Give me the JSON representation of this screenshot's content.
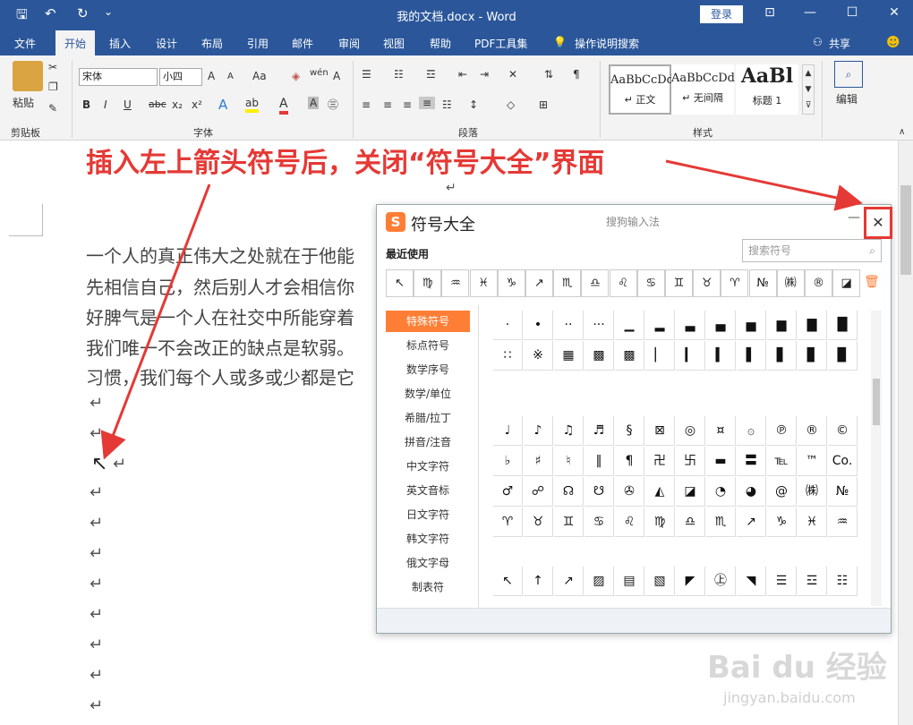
{
  "app": {
    "title": "我的文档.docx - Word",
    "login": "登录"
  },
  "qat": {
    "save": "🖫",
    "undo": "↶",
    "redo": "↻",
    "more": "⌄"
  },
  "window_controls": {
    "ribbon_opts": "⊡",
    "min": "—",
    "max": "☐",
    "close": "✕"
  },
  "tabs": [
    "文件",
    "开始",
    "插入",
    "设计",
    "布局",
    "引用",
    "邮件",
    "审阅",
    "视图",
    "帮助",
    "PDF工具集",
    "操作说明搜索"
  ],
  "share": "共享",
  "ribbon": {
    "clipboard": {
      "paste": "粘贴",
      "label": "剪贴板"
    },
    "font": {
      "name": "宋体",
      "size": "小四",
      "label": "字体",
      "buttons": [
        "A",
        "A",
        "Aa",
        "A"
      ],
      "format": [
        "B",
        "I",
        "U",
        "abc",
        "x₂",
        "x²"
      ]
    },
    "paragraph": {
      "label": "段落"
    },
    "styles": {
      "items": [
        {
          "preview": "AaBbCcDd",
          "name": "↵ 正文"
        },
        {
          "preview": "AaBbCcDd",
          "name": "↵ 无间隔"
        },
        {
          "preview": "AaBl",
          "name": "标题 1"
        }
      ],
      "label": "样式"
    },
    "editing": {
      "label": "编辑"
    }
  },
  "annotation": "插入左上箭头符号后，关闭“符号大全”界面",
  "document": {
    "lines": [
      "一个人的真正伟大之处就在于他能",
      "先相信自己，然后别人才会相信你",
      "好脾气是一个人在社交中所能穿着",
      "我们唯一不会改正的缺点是软弱。",
      "习惯，我们每个人或多或少都是它"
    ],
    "inserted_symbol": "↖",
    "return_mark": "↵"
  },
  "symbol_panel": {
    "logo": "S",
    "title": "符号大全",
    "ime": "搜狗输入法",
    "minimize": "—",
    "close": "✕",
    "recent_label": "最近使用",
    "search_placeholder": "搜索符号",
    "recent": [
      "↖",
      "♍",
      "♒",
      "♓",
      "♑",
      "↗",
      "♏",
      "♎",
      "♌",
      "♋",
      "♊",
      "♉",
      "♈",
      "№",
      "㈱",
      "®",
      "◪"
    ],
    "categories": [
      "特殊符号",
      "标点符号",
      "数学序号",
      "数学/单位",
      "希腊/拉丁",
      "拼音/注音",
      "中文字符",
      "英文音标",
      "日文字符",
      "韩文字符",
      "俄文字母",
      "制表符"
    ],
    "grid_top": [
      "·",
      "•",
      "··",
      "···",
      "▁",
      "▂",
      "▃",
      "▄",
      "▅",
      "▆",
      "▇",
      "█",
      "∷",
      "※",
      "▦",
      "▩",
      "▩",
      "▏",
      "▎",
      "▍",
      "▌",
      "▋",
      "▊",
      "▉"
    ],
    "grid_mid": [
      "♩",
      "♪",
      "♫",
      "♬",
      "§",
      "⊠",
      "◎",
      "¤",
      "۞",
      "℗",
      "®",
      "©",
      "♭",
      "♯",
      "♮",
      "‖",
      "¶",
      "卍",
      "卐",
      "▬",
      "〓",
      "℡",
      "™",
      "Co.",
      "♂",
      "☍",
      "☊",
      "☋",
      "✇",
      "◭",
      "◪",
      "◔",
      "◕",
      "@",
      "㈱",
      "№",
      "♈",
      "♉",
      "♊",
      "♋",
      "♌",
      "♍",
      "♎",
      "♏",
      "↗",
      "♑",
      "♓",
      "♒"
    ],
    "grid_bottom": [
      "↖",
      "↑",
      "↗",
      "▨",
      "▤",
      "▧",
      "◤",
      "㊤",
      "◥",
      "☰",
      "☲",
      "☷"
    ]
  },
  "watermark": {
    "brand": "Bai du 经验",
    "url": "jingyan.baidu.com"
  },
  "colors": {
    "word_blue": "#2b579a",
    "annotation_red": "#e53935",
    "accent_orange": "#ff7e36"
  }
}
